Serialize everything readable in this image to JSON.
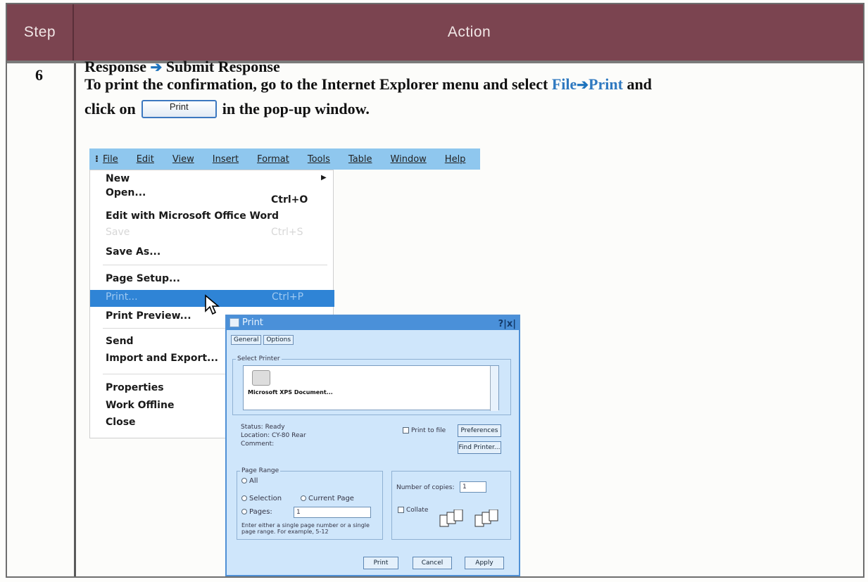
{
  "table": {
    "header_step": "Step",
    "header_action": "Action",
    "step_number": "6",
    "line1_a": "Response",
    "line1_b": "Submit Response",
    "line2_a": "To print the confirmation, go to the Internet Explorer menu and select",
    "line2_file": "File",
    "line2_print": "Print",
    "line2_b": "and",
    "line3_a": "click on",
    "line3_button": "Print",
    "line3_b": "in the pop-up window."
  },
  "menubar": {
    "items": [
      "File",
      "Edit",
      "View",
      "Insert",
      "Format",
      "Tools",
      "Table",
      "Window",
      "Help"
    ]
  },
  "file_menu": {
    "new": "New",
    "open": "Open...",
    "open_shortcut": "Ctrl+O",
    "edit_word": "Edit with Microsoft Office Word",
    "save": "Save",
    "save_shortcut": "Ctrl+S",
    "save_as": "Save As...",
    "page_setup": "Page Setup...",
    "print": "Print...",
    "print_shortcut": "Ctrl+P",
    "print_preview": "Print Preview...",
    "send": "Send",
    "import_export": "Import and Export...",
    "properties": "Properties",
    "work_offline": "Work Offline",
    "close": "Close"
  },
  "print_dialog": {
    "title": "Print",
    "help_close": "?|x|",
    "tab_general": "General",
    "tab_options": "Options",
    "select_printer": "Select Printer",
    "printer_name": "Microsoft XPS Document...",
    "status_label": "Status:",
    "status_value": "Ready",
    "location_label": "Location:",
    "location_value": "CY-80 Rear",
    "comment_label": "Comment:",
    "print_to_file": "Print to file",
    "preferences": "Preferences",
    "find_printer": "Find Printer...",
    "page_range": "Page Range",
    "all": "All",
    "selection": "Selection",
    "current_page": "Current Page",
    "pages": "Pages:",
    "pages_value": "1",
    "hint": "Enter either a single page number or a single page range. For example, 5-12",
    "copies_label": "Number of copies:",
    "copies_value": "1",
    "collate": "Collate",
    "btn_print": "Print",
    "btn_cancel": "Cancel",
    "btn_apply": "Apply"
  }
}
